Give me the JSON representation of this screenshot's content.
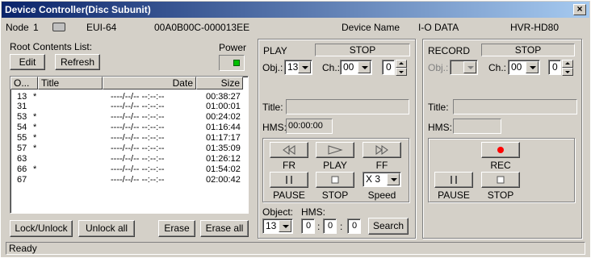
{
  "window": {
    "title": "Device Controller(Disc Subunit)"
  },
  "info": {
    "node_label": "Node",
    "node_value": "1",
    "eui_label": "EUI-64",
    "eui_value": "00A0B00C-000013EE",
    "device_name_label": "Device Name",
    "vendor": "I-O DATA",
    "model": "HVR-HD80"
  },
  "left": {
    "root_contents_label": "Root Contents List:",
    "power_label": "Power",
    "edit_label": "Edit",
    "refresh_label": "Refresh",
    "columns": [
      "O...",
      "Title",
      "Date",
      "Size"
    ],
    "rows": [
      {
        "obj": "13",
        "mark": "*",
        "date": "----/--/-- --:--:--",
        "size": "00:38:27"
      },
      {
        "obj": "31",
        "mark": "",
        "date": "----/--/-- --:--:--",
        "size": "01:00:01"
      },
      {
        "obj": "53",
        "mark": "*",
        "date": "----/--/-- --:--:--",
        "size": "00:24:02"
      },
      {
        "obj": "54",
        "mark": "*",
        "date": "----/--/-- --:--:--",
        "size": "01:16:44"
      },
      {
        "obj": "55",
        "mark": "*",
        "date": "----/--/-- --:--:--",
        "size": "01:17:17"
      },
      {
        "obj": "57",
        "mark": "*",
        "date": "----/--/-- --:--:--",
        "size": "01:35:09"
      },
      {
        "obj": "63",
        "mark": "",
        "date": "----/--/-- --:--:--",
        "size": "01:26:12"
      },
      {
        "obj": "66",
        "mark": "*",
        "date": "----/--/-- --:--:--",
        "size": "01:54:02"
      },
      {
        "obj": "67",
        "mark": "",
        "date": "----/--/-- --:--:--",
        "size": "02:00:42"
      }
    ],
    "lock_unlock_label": "Lock/Unlock",
    "unlock_all_label": "Unlock all",
    "erase_label": "Erase",
    "erase_all_label": "Erase all"
  },
  "play": {
    "group_label": "PLAY",
    "state": "STOP",
    "obj_label": "Obj.:",
    "obj_value": "13",
    "ch_label": "Ch.:",
    "ch_value": "00",
    "spin_value": "0",
    "title_label": "Title:",
    "title_value": "",
    "hms_label": "HMS:",
    "hms_value": "00:00:00",
    "fr_label": "FR",
    "play_label": "PLAY",
    "ff_label": "FF",
    "pause_label": "PAUSE",
    "stop_label": "STOP",
    "speed_label": "Speed",
    "speed_value": "X 3",
    "object_label": "Object:",
    "object_value": "13",
    "seek_hms_label": "HMS:",
    "seek_h": "0",
    "seek_m": "0",
    "seek_s": "0",
    "search_label": "Search"
  },
  "record": {
    "group_label": "RECORD",
    "state": "STOP",
    "obj_label": "Obj.:",
    "obj_value": "",
    "ch_label": "Ch.:",
    "ch_value": "00",
    "spin_value": "0",
    "title_label": "Title:",
    "hms_label": "HMS:",
    "rec_label": "REC",
    "pause_label": "PAUSE",
    "stop_label": "STOP"
  },
  "status": {
    "text": "Ready"
  },
  "colors": {
    "titlebar_start": "#0a246a",
    "titlebar_end": "#a6caf0",
    "power_led": "#00c000",
    "rec_dot": "#ff0000"
  }
}
